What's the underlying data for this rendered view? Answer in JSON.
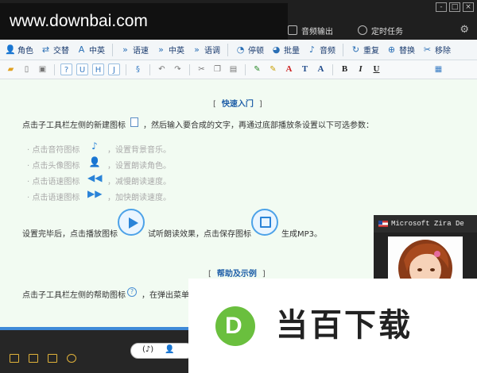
{
  "watermark": "www.downbai.com",
  "title_nav": [
    {
      "label": "音频输出",
      "icon": "audio-output-icon"
    },
    {
      "label": "定时任务",
      "icon": "clock-icon"
    }
  ],
  "window_buttons": [
    "-",
    "□",
    "×"
  ],
  "toolbar1": [
    {
      "label": "角色",
      "icon": "role-icon"
    },
    {
      "label": "交替",
      "icon": "alternate-icon"
    },
    {
      "label": "中英",
      "icon": "cn-en-icon"
    },
    {
      "label": "语速",
      "icon": "speed-icon"
    },
    {
      "label": "中英",
      "icon": "cn-en-icon"
    },
    {
      "label": "语调",
      "icon": "tone-icon"
    },
    {
      "label": "停顿",
      "icon": "pause-icon"
    },
    {
      "label": "批量",
      "icon": "batch-icon"
    },
    {
      "label": "音频",
      "icon": "audio-icon"
    },
    {
      "label": "重复",
      "icon": "repeat-icon"
    },
    {
      "label": "替换",
      "icon": "replace-icon"
    },
    {
      "label": "移除",
      "icon": "remove-icon"
    }
  ],
  "toolbar2": {
    "buttons_left": [
      "?",
      "U",
      "H",
      "J"
    ],
    "format_letters": [
      "A",
      "T",
      "A",
      "B",
      "I",
      "U"
    ]
  },
  "content": {
    "quick_start_title": "快速入门",
    "line_new_prefix": "点击子工具栏左侧的新建图标",
    "line_new_suffix": "，然后输入要合成的文字，再通过底部播放条设置以下可选参数：",
    "bullets": [
      {
        "prefix": "·  点击音符图标",
        "suffix": "，设置背景音乐。",
        "icon": "music-note-icon"
      },
      {
        "prefix": "·  点击头像图标",
        "suffix": "，设置朗读角色。",
        "icon": "person-icon"
      },
      {
        "prefix": "·  点击语速图标",
        "suffix": "，减慢朗读速度。",
        "icon": "rewind-icon"
      },
      {
        "prefix": "·  点击语速图标",
        "suffix": "，加快朗读速度。",
        "icon": "fast-forward-icon"
      }
    ],
    "line_done_1": "设置完毕后，点击播放图标",
    "line_done_2": "试听朗读效果，点击保存图标",
    "line_done_3": "生成MP3。",
    "help_title": "帮助及示例",
    "line_help": "点击子工具栏左侧的帮助图标",
    "line_help_suffix": "，在弹出菜单"
  },
  "voice_panel": {
    "name": "Microsoft Zira De"
  },
  "bottom": {
    "pill_icons": [
      "(♪)",
      "👤"
    ]
  },
  "overlay": {
    "logo_letter": "D",
    "brand": "当百下载"
  },
  "colors": {
    "accent": "#2a83d8",
    "content_bg": "#f2fbf2",
    "dark_bar": "#262626",
    "logo_green": "#6abf3e"
  }
}
